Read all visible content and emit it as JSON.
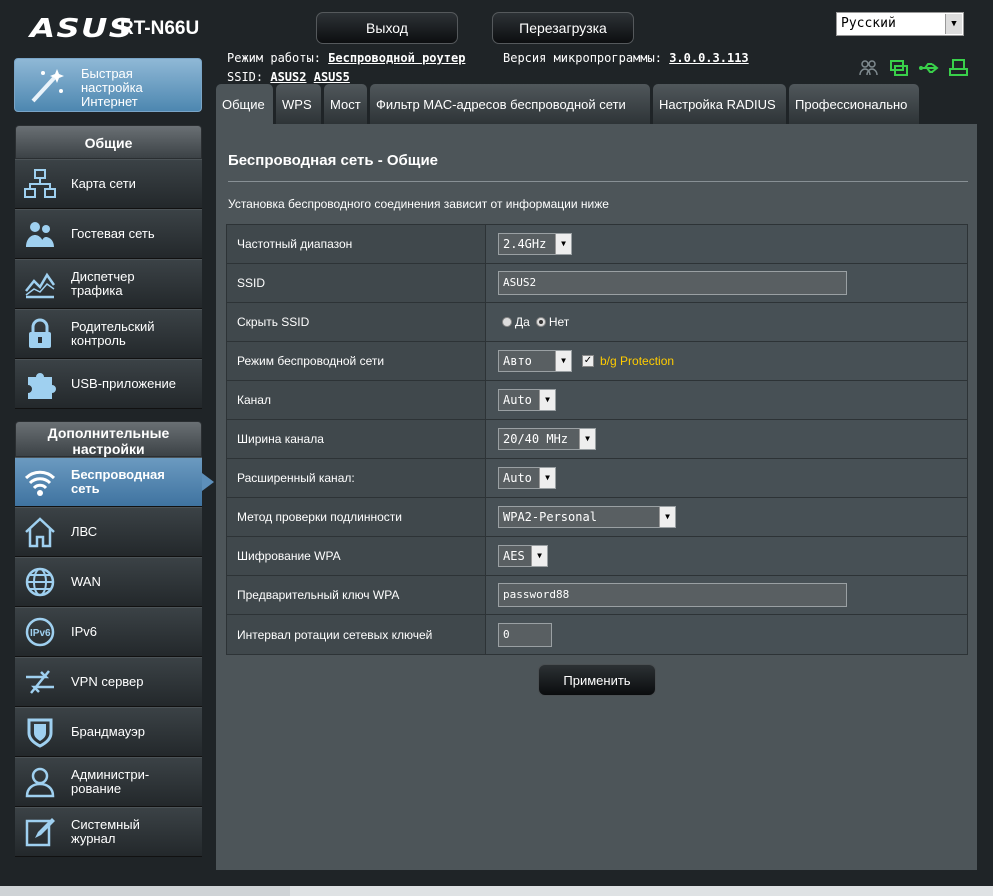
{
  "header": {
    "brand": "ASUS",
    "model": "RT-N66U",
    "logout_label": "Выход",
    "reboot_label": "Перезагрузка",
    "language": "Русский",
    "mode_label": "Режим работы:",
    "mode_value": "Беспроводной роутер",
    "fw_label": "Версия микропрограммы:",
    "fw_value": "3.0.0.3.113",
    "ssid_label": "SSID:",
    "ssid1": "ASUS2",
    "ssid2": "ASUS5",
    "status_icons": [
      "clients-icon",
      "network-icon",
      "usb-icon",
      "printer-icon"
    ],
    "accent_color": "#3f73a0"
  },
  "sidebar": {
    "quick_setup": "Быстрая настройка Интернет",
    "section_general": "Общие",
    "general_items": [
      {
        "label": "Карта сети",
        "icon": "network-map-icon"
      },
      {
        "label": "Гостевая сеть",
        "icon": "guest-network-icon"
      },
      {
        "label": "Диспетчер трафика",
        "icon": "traffic-manager-icon"
      },
      {
        "label": "Родительский контроль",
        "icon": "parental-control-icon"
      },
      {
        "label": "USB-приложение",
        "icon": "usb-app-icon"
      }
    ],
    "section_advanced": "Дополнительные настройки",
    "advanced_items": [
      {
        "label": "Беспроводная сеть",
        "icon": "wireless-icon",
        "active": true
      },
      {
        "label": "ЛВС",
        "icon": "lan-icon"
      },
      {
        "label": "WAN",
        "icon": "wan-icon"
      },
      {
        "label": "IPv6",
        "icon": "ipv6-icon"
      },
      {
        "label": "VPN сервер",
        "icon": "vpn-icon"
      },
      {
        "label": "Брандмауэр",
        "icon": "firewall-icon"
      },
      {
        "label": "Администри-рование",
        "icon": "admin-icon"
      },
      {
        "label": "Системный журнал",
        "icon": "syslog-icon"
      }
    ]
  },
  "tabs": [
    "Общие",
    "WPS",
    "Мост",
    "Фильтр MAC-адресов беспроводной сети",
    "Настройка RADIUS",
    "Профессионально"
  ],
  "page": {
    "title": "Беспроводная сеть - Общие",
    "description": "Установка беспроводного соединения зависит от информации ниже",
    "fields": {
      "band": {
        "label": "Частотный диапазон",
        "value": "2.4GHz"
      },
      "ssid": {
        "label": "SSID",
        "value": "ASUS2"
      },
      "hide_ssid": {
        "label": "Скрыть SSID",
        "yes": "Да",
        "no": "Нет",
        "selected": "no"
      },
      "mode": {
        "label": "Режим беспроводной сети",
        "value": "Авто",
        "bg_protection": "b/g Protection"
      },
      "channel": {
        "label": "Канал",
        "value": "Auto"
      },
      "bandwidth": {
        "label": "Ширина канала",
        "value": "20/40 MHz"
      },
      "ext_channel": {
        "label": "Расширенный канал:",
        "value": "Auto"
      },
      "auth": {
        "label": "Метод проверки подлинности",
        "value": "WPA2-Personal"
      },
      "encryption": {
        "label": "Шифрование WPA",
        "value": "AES"
      },
      "psk": {
        "label": "Предварительный ключ WPA",
        "value": "password88"
      },
      "rotation": {
        "label": "Интервал ротации сетевых ключей",
        "value": "0"
      }
    },
    "apply_label": "Применить"
  }
}
